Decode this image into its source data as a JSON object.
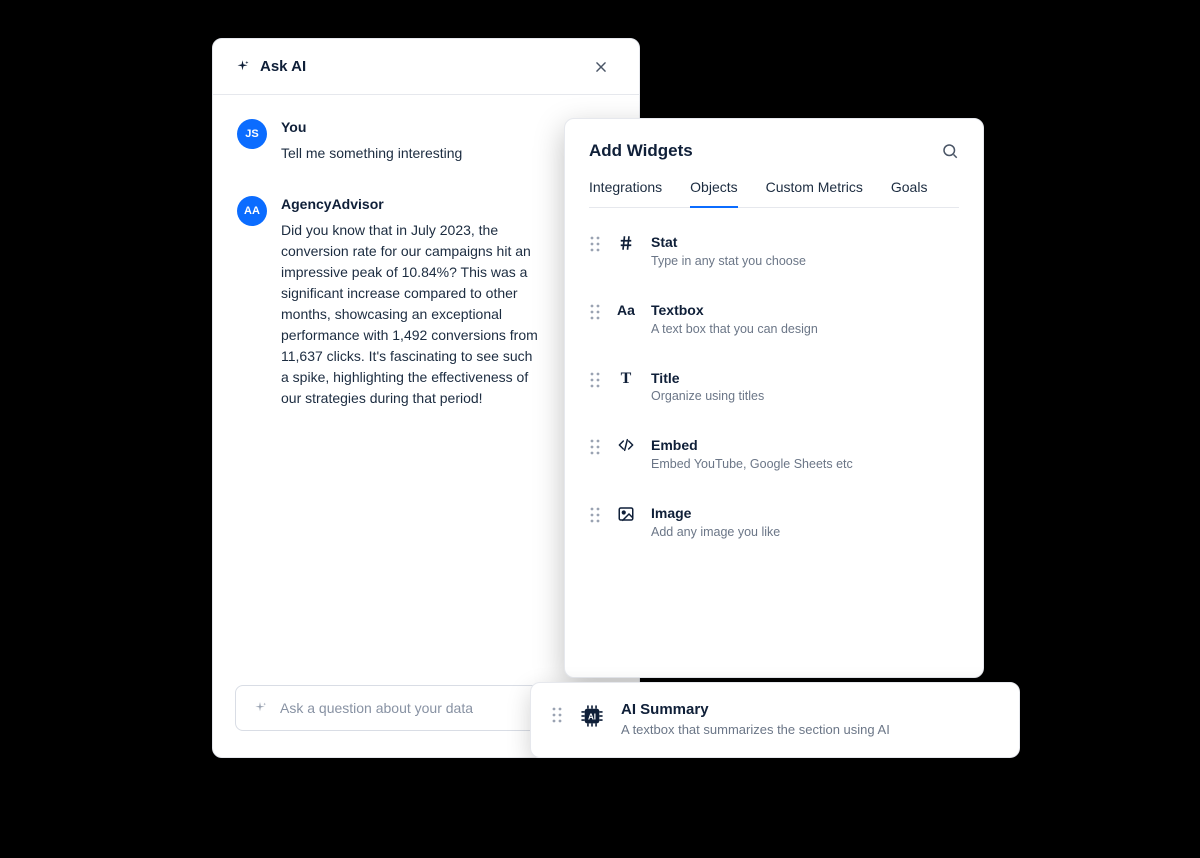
{
  "ask_ai": {
    "title": "Ask AI",
    "input_placeholder": "Ask a question about your data",
    "messages": [
      {
        "avatar_initials": "JS",
        "name": "You",
        "text": "Tell me something interesting"
      },
      {
        "avatar_initials": "AA",
        "name": "AgencyAdvisor",
        "text": "Did you know that in July 2023, the conversion rate for our campaigns hit an impressive peak of 10.84%? This was a significant increase compared to other months, showcasing an exceptional performance with 1,492 conversions from 11,637 clicks. It's fascinating to see such a spike, highlighting the effectiveness of our strategies during that period!"
      }
    ]
  },
  "widgets": {
    "title": "Add Widgets",
    "tabs": [
      {
        "label": "Integrations",
        "active": false
      },
      {
        "label": "Objects",
        "active": true
      },
      {
        "label": "Custom Metrics",
        "active": false
      },
      {
        "label": "Goals",
        "active": false
      }
    ],
    "items": [
      {
        "icon": "hash-icon",
        "label": "Stat",
        "desc": "Type in any stat you choose"
      },
      {
        "icon": "aa-icon",
        "label": "Textbox",
        "desc": "A text box that you can design"
      },
      {
        "icon": "title-t-icon",
        "label": "Title",
        "desc": "Organize using titles"
      },
      {
        "icon": "embed-icon",
        "label": "Embed",
        "desc": "Embed YouTube, Google Sheets etc"
      },
      {
        "icon": "image-icon",
        "label": "Image",
        "desc": "Add any image you like"
      }
    ],
    "summary": {
      "label": "AI Summary",
      "desc": "A textbox that summarizes the section using AI"
    }
  }
}
